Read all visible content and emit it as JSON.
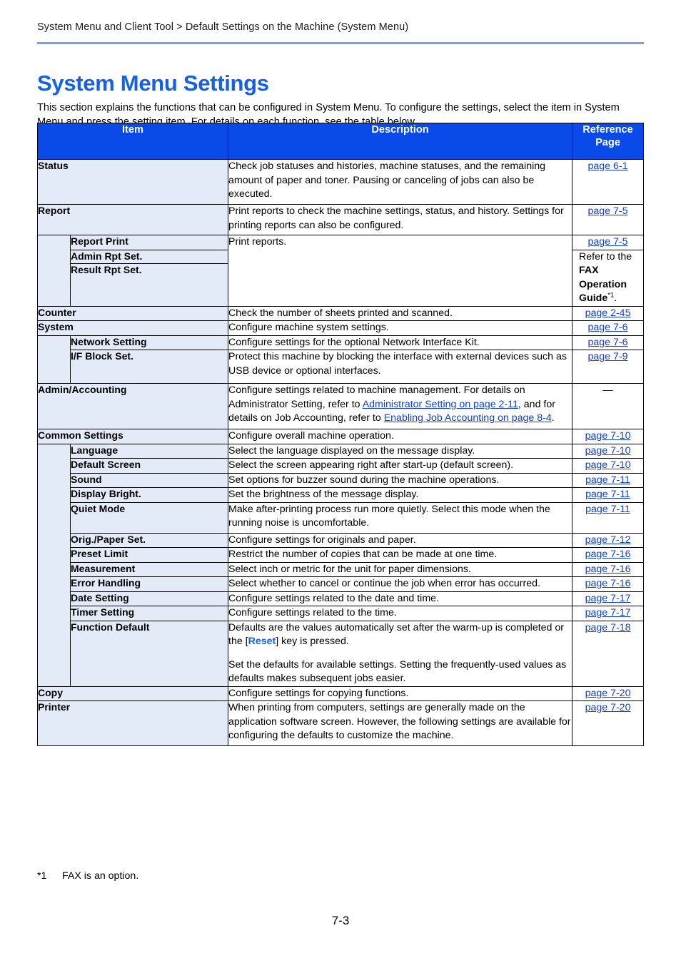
{
  "header": {
    "breadcrumb": "System Menu and Client Tool > Default Settings on the Machine (System Menu)"
  },
  "title": "System Menu Settings",
  "intro": "This section explains the functions that can be configured in System Menu. To configure the settings, select the item in System Menu and press the setting item. For details on each function, see the table below.",
  "table": {
    "columns": {
      "item": "Item",
      "description": "Description",
      "reference": "Reference\nPage",
      "reference_line1": "Reference",
      "reference_line2": "Page"
    },
    "rows": [
      {
        "level": 1,
        "item": "Status",
        "description": "Check job statuses and histories, machine statuses, and the remaining amount of paper and toner. Pausing or canceling of jobs can also be executed.",
        "reference": "page 6-1"
      },
      {
        "level": 1,
        "item": "Report",
        "description": "Print reports to check the machine settings, status, and history. Settings for printing reports can also be configured.",
        "reference": "page 7-5"
      },
      {
        "level": 2,
        "item": "Report Print",
        "description": "Print reports.",
        "reference": "page 7-5"
      },
      {
        "level": 2,
        "item": "Admin Rpt Set.",
        "description": "",
        "reference": ""
      },
      {
        "level": 2,
        "item": "Result Rpt Set.",
        "description": "",
        "reference": "Refer to the FAX Operation Guide*1."
      },
      {
        "level": 1,
        "item": "Counter",
        "description": "Check the number of sheets printed and scanned.",
        "reference": "page 2-45"
      },
      {
        "level": 1,
        "item": "System",
        "description": "Configure machine system settings.",
        "reference": "page 7-6"
      },
      {
        "level": 2,
        "item": "Network Setting",
        "description": "Configure settings for the optional Network Interface Kit.",
        "reference": "page 7-6"
      },
      {
        "level": 2,
        "item": "I/F Block Set.",
        "description": "Protect this machine by blocking the interface with external devices such as USB device or optional interfaces.",
        "reference": "page 7-9"
      },
      {
        "level": 1,
        "item": "Admin/Accounting",
        "description": "Configure settings related to machine management. For details on Administrator Setting, refer to Administrator Setting on page 2-11, and for details on Job Accounting, refer to Enabling Job Accounting on page 8-4 .",
        "reference": "—"
      },
      {
        "level": 1,
        "item": "Common Settings",
        "description": "Configure overall machine operation.",
        "reference": "page 7-10"
      },
      {
        "level": 2,
        "item": "Language",
        "description": "Select the language displayed on the message display.",
        "reference": "page 7-10"
      },
      {
        "level": 2,
        "item": "Default Screen",
        "description": "Select the screen appearing right after start-up (default screen).",
        "reference": "page 7-10"
      },
      {
        "level": 2,
        "item": "Sound",
        "description": "Set options for buzzer sound during the machine operations.",
        "reference": "page 7-11"
      },
      {
        "level": 2,
        "item": "Display Bright.",
        "description": "Set the brightness of the message display.",
        "reference": "page 7-11"
      },
      {
        "level": 2,
        "item": "Quiet Mode",
        "description": "Make after-printing process run more quietly. Select this mode when the running noise is uncomfortable.",
        "reference": "page 7-11"
      },
      {
        "level": 2,
        "item": "Orig./Paper Set.",
        "description": "Configure settings for originals and paper.",
        "reference": "page 7-12"
      },
      {
        "level": 2,
        "item": "Preset Limit",
        "description": "Restrict the number of copies that can be made at one time.",
        "reference": "page 7-16"
      },
      {
        "level": 2,
        "item": "Measurement",
        "description": "Select inch or metric for the unit for paper dimensions.",
        "reference": "page 7-16"
      },
      {
        "level": 2,
        "item": "Error Handling",
        "description": "Select whether to cancel or continue the job when error has occurred.",
        "reference": "page 7-16"
      },
      {
        "level": 2,
        "item": "Date Setting",
        "description": "Configure settings related to the date and time.",
        "reference": "page 7-17"
      },
      {
        "level": 2,
        "item": "Timer Setting",
        "description": "Configure settings related to the time.",
        "reference": "page 7-17"
      },
      {
        "level": 2,
        "item": "Function Default",
        "description": "Defaults are the values automatically set after the warm-up is completed or the [Reset] key is pressed. Set the defaults for available settings. Setting the frequently-used values as defaults makes subsequent jobs easier.",
        "reference": "page 7-18"
      },
      {
        "level": 1,
        "item": "Copy",
        "description": "Configure settings for copying functions.",
        "reference": "page 7-20"
      },
      {
        "level": 1,
        "item": "Printer",
        "description": "When printing from computers, settings are generally made on the application software screen. However, the following settings are available for configuring the defaults to customize the machine.",
        "reference": "page 7-20"
      }
    ],
    "cells": {
      "status_item": "Status",
      "status_desc": "Check job statuses and histories, machine statuses, and the remaining amount of paper and toner. Pausing or canceling of jobs can also be executed.",
      "status_ref": "page 6-1",
      "report_item": "Report",
      "report_desc": "Print reports to check the machine settings, status, and history. Settings for printing reports can also be configured.",
      "report_ref": "page 7-5",
      "report_print_item": "Report Print",
      "report_print_desc": "Print reports.",
      "report_print_ref": "page 7-5",
      "admin_rpt_item": "Admin Rpt Set.",
      "result_rpt_item": "Result Rpt Set.",
      "fax_ref_pre": "Refer to the ",
      "fax_ref_bold": "FAX Operation Guide",
      "fax_ref_sup": "*1",
      "fax_ref_post": ".",
      "counter_item": "Counter",
      "counter_desc": "Check the number of sheets printed and scanned.",
      "counter_ref": "page 2-45",
      "system_item": "System",
      "system_desc": "Configure machine system settings.",
      "system_ref": "page 7-6",
      "network_item": "Network Setting",
      "network_desc": "Configure settings for the optional Network Interface Kit.",
      "network_ref": "page 7-6",
      "ifblock_item": "I/F Block Set.",
      "ifblock_desc": "Protect this machine by blocking the interface with external devices such as USB device or optional interfaces.",
      "ifblock_ref": "page 7-9",
      "admin_item": "Admin/Accounting",
      "admin_desc_1": "Configure settings related to machine management. For details on Administrator Setting, refer to ",
      "admin_link_1": "Administrator Setting on page 2-11",
      "admin_desc_2": ", and for details on Job Accounting, refer to ",
      "admin_link_2": "Enabling Job Accounting on page 8-4",
      "admin_desc_3": ".",
      "admin_ref": "—",
      "common_item": "Common Settings",
      "common_desc": "Configure overall machine operation.",
      "common_ref": "page 7-10",
      "language_item": "Language",
      "language_desc": "Select the language displayed on the message display.",
      "language_ref": "page 7-10",
      "defscreen_item": "Default Screen",
      "defscreen_desc": "Select the screen appearing right after start-up (default screen).",
      "defscreen_ref": "page 7-10",
      "sound_item": "Sound",
      "sound_desc": "Set options for buzzer sound during the machine operations.",
      "sound_ref": "page 7-11",
      "bright_item": "Display Bright.",
      "bright_desc": "Set the brightness of the message display.",
      "bright_ref": "page 7-11",
      "quiet_item": "Quiet Mode",
      "quiet_desc": "Make after-printing process run more quietly. Select this mode when the running noise is uncomfortable.",
      "quiet_ref": "page 7-11",
      "paper_item": "Orig./Paper Set.",
      "paper_desc": "Configure settings for originals and paper.",
      "paper_ref": "page 7-12",
      "preset_item": "Preset Limit",
      "preset_desc": "Restrict the number of copies that can be made at one time.",
      "preset_ref": "page 7-16",
      "measure_item": "Measurement",
      "measure_desc": "Select inch or metric for the unit for paper dimensions.",
      "measure_ref": "page 7-16",
      "error_item": "Error Handling",
      "error_desc": "Select whether to cancel or continue the job when error has occurred.",
      "error_ref": "page 7-16",
      "date_item": "Date Setting",
      "date_desc": "Configure settings related to the date and time.",
      "date_ref": "page 7-17",
      "timer_item": "Timer Setting",
      "timer_desc": "Configure settings related to the time.",
      "timer_ref": "page 7-17",
      "funcdef_item": "Function Default",
      "funcdef_desc_1a": "Defaults are the values automatically set after the warm-up is completed or the [",
      "funcdef_reset": "Reset",
      "funcdef_desc_1b": "] key is pressed.",
      "funcdef_desc_2": "Set the defaults for available settings. Setting the frequently-used values as defaults makes subsequent jobs easier.",
      "funcdef_ref": "page 7-18",
      "copy_item": "Copy",
      "copy_desc": "Configure settings for copying functions.",
      "copy_ref": "page 7-20",
      "printer_item": "Printer",
      "printer_desc": "When printing from computers, settings are generally made on the application software screen. However, the following settings are available for configuring the defaults to customize the machine.",
      "printer_ref": "page 7-20"
    }
  },
  "footnote": {
    "marker": "*1",
    "text": "FAX is an option."
  },
  "page_number": "7-3",
  "colors": {
    "header_blue": "#0a4ae8",
    "title_blue": "#1560e8",
    "rule_blue": "#79a3e8",
    "item_bg": "#e3eaf8",
    "link_blue": "#1040e0"
  }
}
